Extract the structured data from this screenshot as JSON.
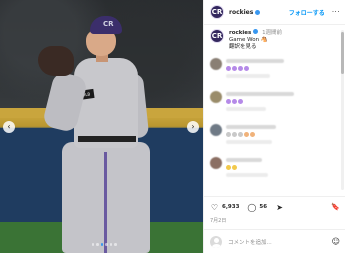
{
  "media": {
    "prev_arrow": "‹",
    "next_arrow": "›",
    "patch_text": "MLB",
    "cap_logo": "CR"
  },
  "header": {
    "avatar": "CR",
    "username": "rockies",
    "follow_label": "フォローする",
    "more": "···"
  },
  "caption": {
    "avatar": "CR",
    "username": "rockies",
    "time": "1週間前",
    "line1": "Game Won 🐴",
    "line2": "翻訳を見る"
  },
  "actions": {
    "like_icon": "♡",
    "like_count": "6,933",
    "comment_icon": "◯",
    "comment_count": "56",
    "share_icon": "➤",
    "save_icon": "🔖",
    "date": "7月2日"
  },
  "composer": {
    "placeholder": "コメントを追加...",
    "emoji_icon": "☺"
  },
  "colors": {
    "accent": "#0095f6",
    "brand_purple": "#33275e",
    "verified": "#3897f0"
  }
}
